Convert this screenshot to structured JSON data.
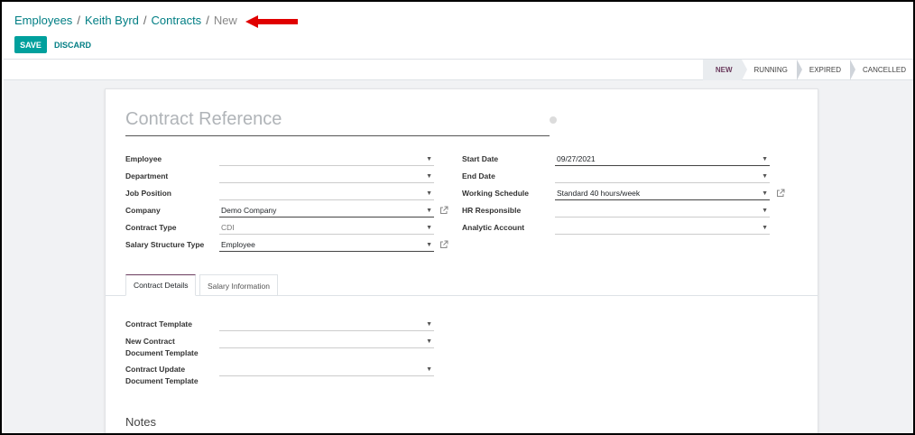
{
  "breadcrumb": [
    {
      "label": "Employees"
    },
    {
      "label": "Keith Byrd"
    },
    {
      "label": "Contracts"
    },
    {
      "label": "New"
    }
  ],
  "breadcrumb_separator": "/",
  "buttons": {
    "save": "SAVE",
    "discard": "DISCARD"
  },
  "stages": [
    {
      "label": "NEW",
      "current": true
    },
    {
      "label": "RUNNING",
      "current": false
    },
    {
      "label": "EXPIRED",
      "current": false
    },
    {
      "label": "CANCELLED",
      "current": false
    }
  ],
  "form": {
    "reference_placeholder": "Contract Reference",
    "left": {
      "employee": {
        "label": "Employee",
        "value": ""
      },
      "department": {
        "label": "Department",
        "value": ""
      },
      "job_position": {
        "label": "Job Position",
        "value": ""
      },
      "company": {
        "label": "Company",
        "value": "Demo Company"
      },
      "contract_type": {
        "label": "Contract Type",
        "value": "CDI"
      },
      "salary_structure_type": {
        "label": "Salary Structure Type",
        "value": "Employee"
      }
    },
    "right": {
      "start_date": {
        "label": "Start Date",
        "value": "09/27/2021"
      },
      "end_date": {
        "label": "End Date",
        "value": ""
      },
      "working_schedule": {
        "label": "Working Schedule",
        "value": "Standard 40 hours/week"
      },
      "hr_responsible": {
        "label": "HR Responsible",
        "value": ""
      },
      "analytic_account": {
        "label": "Analytic Account",
        "value": ""
      }
    }
  },
  "tabs": [
    {
      "label": "Contract Details",
      "active": true
    },
    {
      "label": "Salary Information",
      "active": false
    }
  ],
  "details": {
    "contract_template": {
      "label": "Contract Template",
      "value": ""
    },
    "new_contract_doc_template": {
      "label_line1": "New Contract",
      "label_line2": "Document Template",
      "value": ""
    },
    "contract_update_doc_template": {
      "label_line1": "Contract Update",
      "label_line2": "Document Template",
      "value": ""
    }
  },
  "notes_title": "Notes",
  "colors": {
    "accent": "#017e84",
    "primary_button": "#00a09d",
    "annotation_arrow": "#e00000"
  }
}
